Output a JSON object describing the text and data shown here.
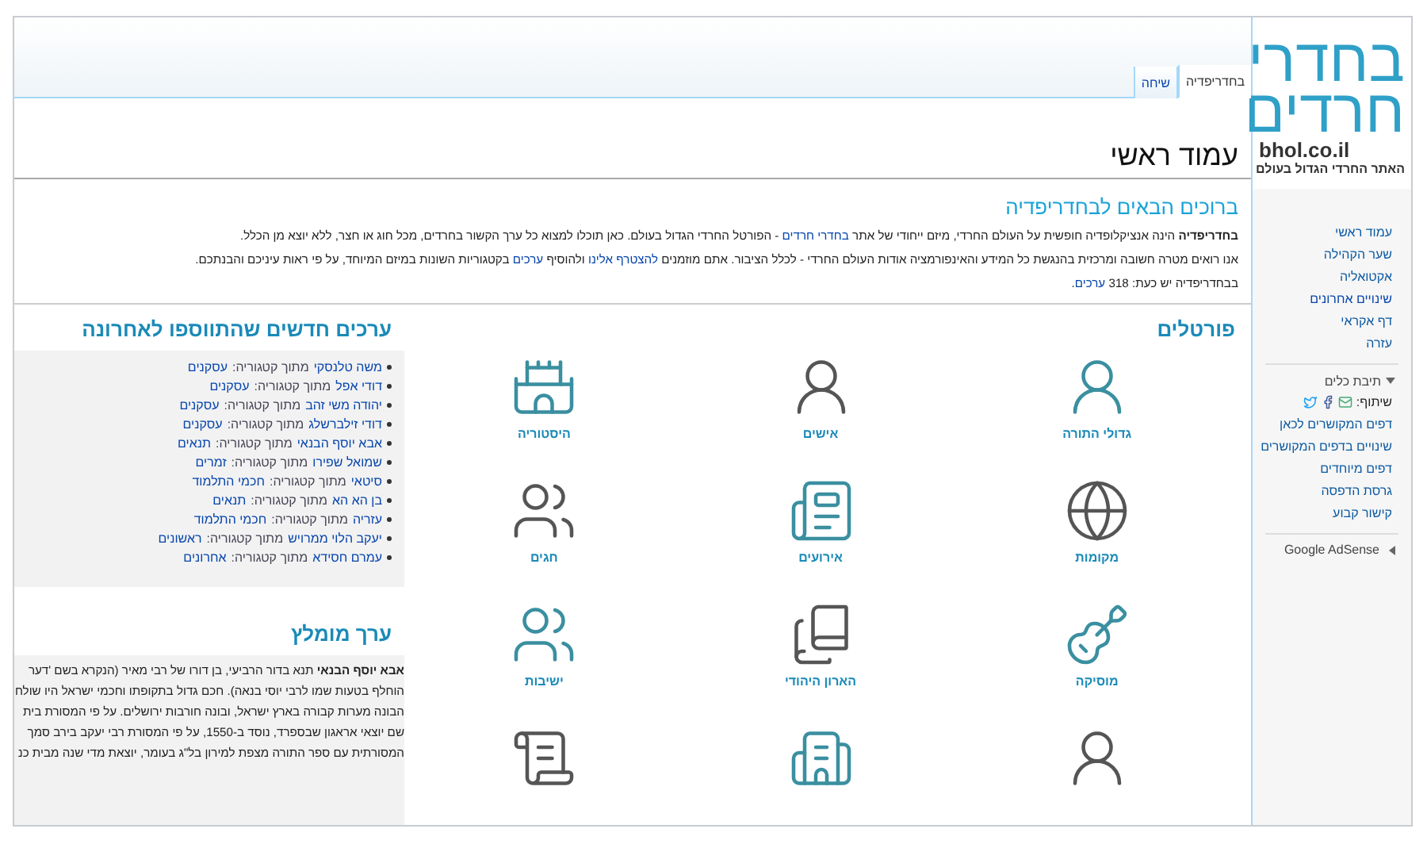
{
  "logo": {
    "line_1": "בחדרי",
    "line_2": "חרדים",
    "domain": "bhol.co.il",
    "tagline": "האתר החרדי הגדול בעולם"
  },
  "navigation": [
    {
      "label": "עמוד ראשי"
    },
    {
      "label": "שער הקהילה"
    },
    {
      "label": "אקטואליה"
    },
    {
      "label": "שינויים אחרונים"
    },
    {
      "label": "דף אקראי"
    },
    {
      "label": "עזרה"
    }
  ],
  "toolbox": {
    "title": "תיבת כלים",
    "expanded": true,
    "share_label": "שיתוף:",
    "links": [
      {
        "label": "דפים המקושרים לכאן"
      },
      {
        "label": "שינויים בדפים המקושרים"
      },
      {
        "label": "דפים מיוחדים"
      },
      {
        "label": "גרסת הדפסה"
      },
      {
        "label": "קישור קבוע"
      }
    ]
  },
  "adsense": {
    "title": "Google AdSense",
    "expanded": false
  },
  "tabs": [
    {
      "label": "בחדריפדיה",
      "selected": true
    },
    {
      "label": "שיחה",
      "selected": false
    }
  ],
  "page_title": "עמוד ראשי",
  "welcome": {
    "title": "ברוכים הבאים לבחדריפדיה",
    "paragraphs": [
      [
        {
          "text": "**בחדריפדיה** הינה אנציקלופדיה חופשית על העולם החרדי, מיזם ייחודי של אתר ",
          "link": false
        },
        {
          "text": "בחדרי חרדים",
          "link": true
        },
        {
          "text": " - הפורטל החרדי הגדול בעולם. כאן תוכלו למצוא כל ערך הקשור בחרדים, מכל חוג או חצר, ללא יוצא מן הכלל.",
          "link": false
        }
      ],
      [
        {
          "text": "אנו רואים מטרה חשובה ומרכזית בהנגשת כל המידע והאינפורמציה אודות העולם החרדי - לכלל הציבור. אתם מוזמנים ",
          "link": false
        },
        {
          "text": "להצטרף אלינו",
          "link": true
        },
        {
          "text": " ולהוסיף ",
          "link": false
        },
        {
          "text": "ערכים",
          "link": true
        },
        {
          "text": " בקטגוריות השונות במיזם המיוחד, על פי ראות עיניכם והבנתכם.",
          "link": false
        }
      ],
      [
        {
          "text": "בבחדריפדיה יש כעת: 318 ",
          "link": false
        },
        {
          "text": "ערכים",
          "link": true
        },
        {
          "text": ".",
          "link": false
        }
      ]
    ]
  },
  "portals": {
    "title": "פורטלים",
    "items": [
      {
        "kind": "portal",
        "label": "גדולי התורה"
      },
      {
        "kind": "portal",
        "label": "אישים"
      },
      {
        "kind": "portal",
        "label": "היסטוריה"
      },
      {
        "kind": "portal",
        "label": "מקומות"
      },
      {
        "kind": "portal",
        "label": "אירועים"
      },
      {
        "kind": "portal",
        "label": "חגים"
      },
      {
        "kind": "portal",
        "label": "מוסיקה"
      },
      {
        "kind": "portal",
        "label": "הארון היהודי"
      },
      {
        "kind": "portal",
        "label": "ישיבות"
      },
      {
        "kind": "cut"
      },
      {
        "kind": "cut"
      },
      {
        "kind": "cut"
      }
    ]
  },
  "recent": {
    "title": "ערכים חדשים שהתווספו לאחרונה",
    "items": [
      {
        "title": "משה טלנסקי",
        "from": "מתוך קטגוריה:",
        "category": "עסקנים"
      },
      {
        "title": "דודי אפל",
        "from": "מתוך קטגוריה:",
        "category": "עסקנים"
      },
      {
        "title": "יהודה משי זהב",
        "from": "מתוך קטגוריה:",
        "category": "עסקנים"
      },
      {
        "title": "דודי זילברשלג",
        "from": "מתוך קטגוריה:",
        "category": "עסקנים"
      },
      {
        "title": "אבא יוסף הבנאי",
        "from": "מתוך קטגוריה:",
        "category": "תנאים"
      },
      {
        "title": "שמואל שפירו",
        "from": "מתוך קטגוריה:",
        "category": "זמרים"
      },
      {
        "title": "סיטאי",
        "from": "מתוך קטגוריה:",
        "category": "חכמי התלמוד"
      },
      {
        "title": "בן הא הא",
        "from": "מתוך קטגוריה:",
        "category": "תנאים"
      },
      {
        "title": "עזריה",
        "from": "מתוך קטגוריה:",
        "category": "חכמי התלמוד"
      },
      {
        "title": "יעקב הלוי ממרויש",
        "from": "מתוך קטגוריה:",
        "category": "ראשונים"
      },
      {
        "title": "עמרם חסידא",
        "from": "מתוך קטגוריה:",
        "category": "אחרונים"
      }
    ]
  },
  "featured": {
    "title": "ערך מומלץ",
    "lines": [
      "**אבא יוסף הבנאי** תנא בדור הרביעי, בן דורו של רבי מאיר (הנקרא בשם 'דער",
      "הוחלף בטעות שמו לרבי יוסי בנאה). חכם גדול בתקופתו וחכמי ישראל היו שולח",
      "הבונה מערות קבורה בארץ ישראל, ובונה חורבות ירושלים. על פי המסורת בית",
      "שם יוצאי אראגון שבספרד, נוסד ב-1550, על פי המסורת רבי יעקב בירב סמך",
      "המסורתית עם ספר התורה מצפת למירון בל\"ג בעומר, יוצאת מדי שנה מבית כנ"
    ]
  }
}
